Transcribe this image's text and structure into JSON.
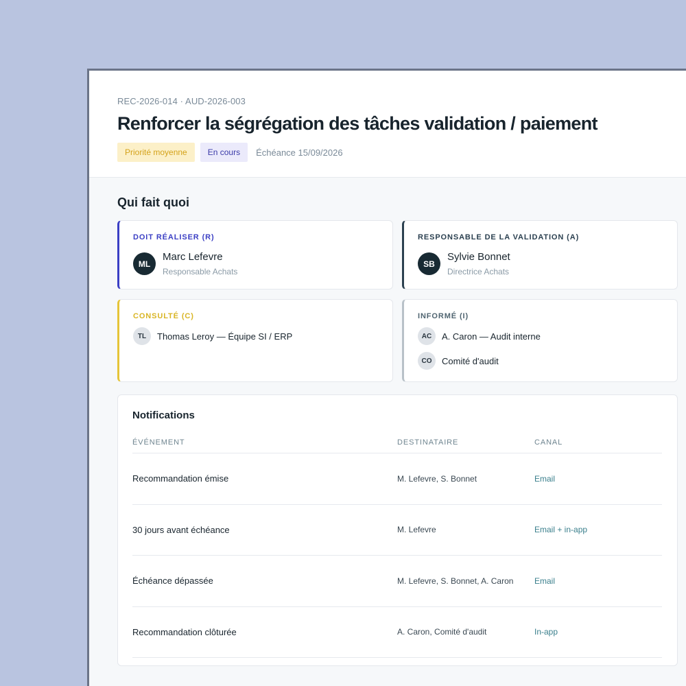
{
  "header": {
    "refs": "REC-2026-014 · AUD-2026-003",
    "title": "Renforcer la ségrégation des tâches validation / paiement",
    "priority_badge": "Priorité moyenne",
    "status_badge": "En cours",
    "due": "Échéance 15/09/2026"
  },
  "raci": {
    "section_title": "Qui fait quoi",
    "responsible": {
      "role": "DOIT RÉALISER (R)",
      "accent": "#3b3fc4",
      "initials": "ML",
      "name": "Marc Lefevre",
      "position": "Responsable Achats"
    },
    "accountable": {
      "role": "RESPONSABLE DE LA VALIDATION (A)",
      "accent": "#2b4050",
      "initials": "SB",
      "name": "Sylvie Bonnet",
      "position": "Directrice Achats"
    },
    "consulted": {
      "role": "CONSULTÉ (C)",
      "accent": "#e5c438",
      "people": [
        {
          "initials": "TL",
          "label": "Thomas Leroy — Équipe SI / ERP"
        }
      ]
    },
    "informed": {
      "role": "INFORMÉ (I)",
      "accent": "#b8c1c8",
      "people": [
        {
          "initials": "AC",
          "label": "A. Caron — Audit interne"
        },
        {
          "initials": "CO",
          "label": "Comité d'audit"
        }
      ]
    }
  },
  "notifications": {
    "title": "Notifications",
    "columns": [
      "ÉVÉNEMENT",
      "DESTINATAIRE",
      "CANAL"
    ],
    "rows": [
      {
        "event": "Recommandation émise",
        "recipient": "M. Lefevre, S. Bonnet",
        "channel": "Email"
      },
      {
        "event": "30 jours avant échéance",
        "recipient": "M. Lefevre",
        "channel": "Email + in-app"
      },
      {
        "event": "Échéance dépassée",
        "recipient": "M. Lefevre, S. Bonnet, A. Caron",
        "channel": "Email"
      },
      {
        "event": "Recommandation clôturée",
        "recipient": "A. Caron, Comité d'audit",
        "channel": "In-app"
      }
    ]
  }
}
